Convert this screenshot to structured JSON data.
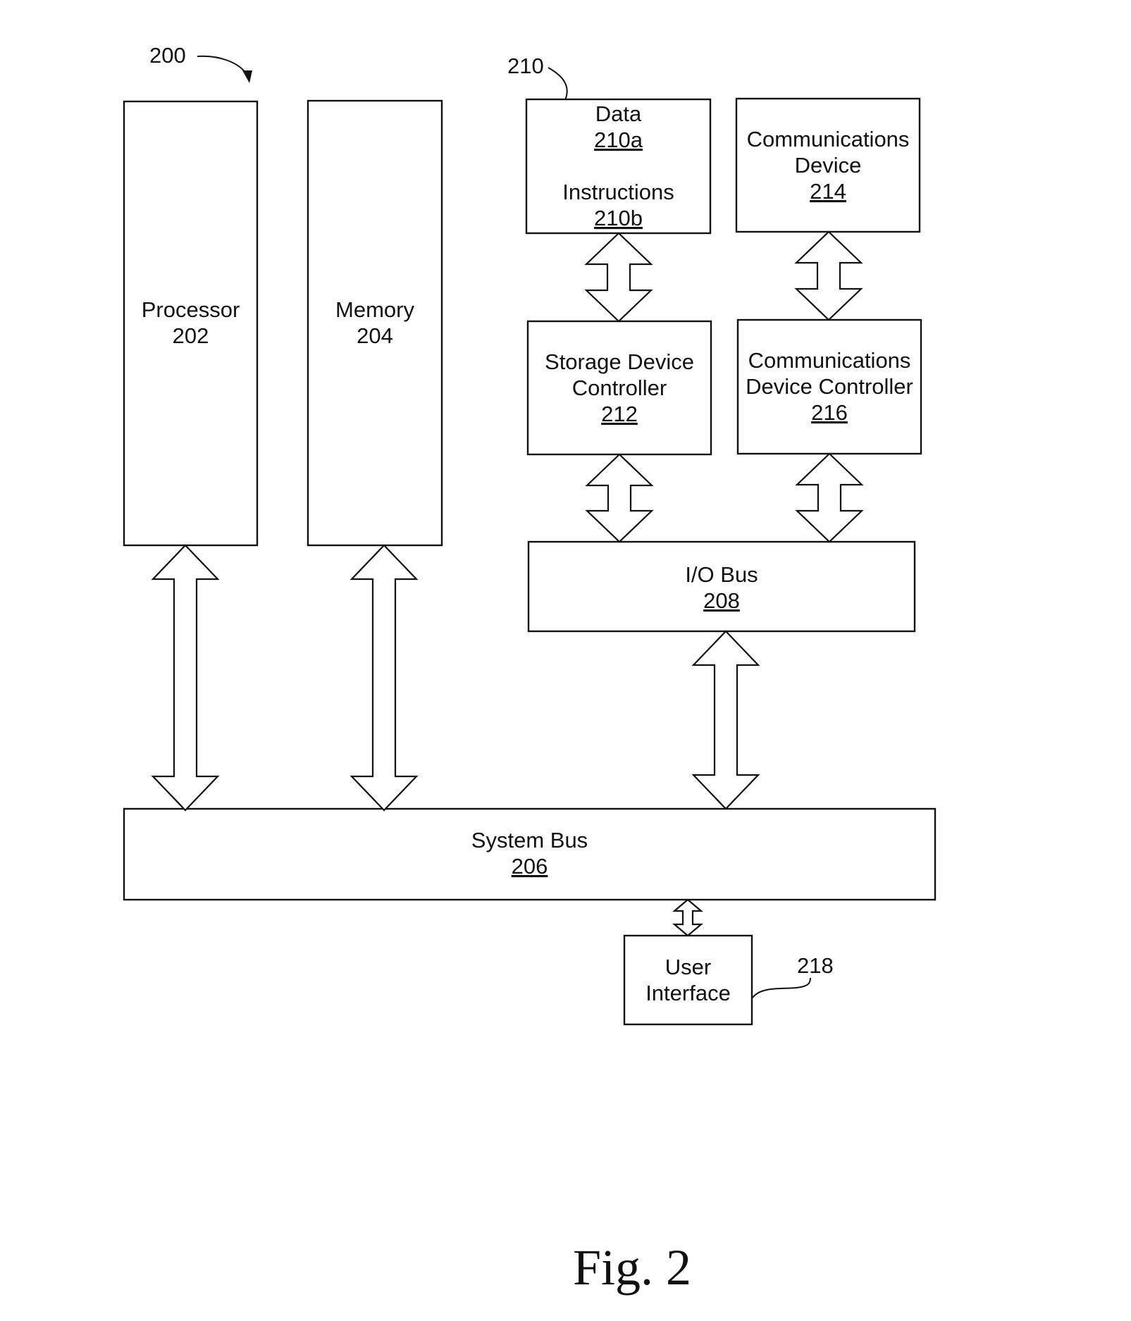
{
  "figure": {
    "caption": "Fig. 2",
    "ref_200": "200",
    "ref_210": "210",
    "ref_218": "218"
  },
  "blocks": {
    "processor": {
      "lines": [
        "Processor",
        "202"
      ],
      "underlined": []
    },
    "memory": {
      "lines": [
        "Memory",
        "204"
      ],
      "underlined": []
    },
    "data_instructions": {
      "lines": [
        "Data",
        "210a",
        "",
        "Instructions",
        "210b"
      ],
      "underlined": [
        1,
        4
      ]
    },
    "comm_device": {
      "lines": [
        "Communications",
        "Device",
        "214"
      ],
      "underlined": [
        2
      ]
    },
    "storage_controller": {
      "lines": [
        "Storage Device",
        "Controller",
        "212"
      ],
      "underlined": [
        2
      ]
    },
    "comm_controller": {
      "lines": [
        "Communications",
        "Device Controller",
        "216"
      ],
      "underlined": [
        2
      ]
    },
    "io_bus": {
      "lines": [
        "I/O Bus",
        "208"
      ],
      "underlined": [
        1
      ]
    },
    "system_bus": {
      "lines": [
        "System Bus",
        "206"
      ],
      "underlined": [
        1
      ]
    },
    "user_interface": {
      "lines": [
        "User",
        "Interface"
      ],
      "underlined": []
    }
  },
  "connections": [
    {
      "from": "data_instructions",
      "to": "storage_controller",
      "type": "bidirectional"
    },
    {
      "from": "comm_device",
      "to": "comm_controller",
      "type": "bidirectional"
    },
    {
      "from": "storage_controller",
      "to": "io_bus",
      "type": "bidirectional"
    },
    {
      "from": "comm_controller",
      "to": "io_bus",
      "type": "bidirectional"
    },
    {
      "from": "io_bus",
      "to": "system_bus",
      "type": "bidirectional"
    },
    {
      "from": "processor",
      "to": "system_bus",
      "type": "bidirectional"
    },
    {
      "from": "memory",
      "to": "system_bus",
      "type": "bidirectional"
    },
    {
      "from": "system_bus",
      "to": "user_interface",
      "type": "bidirectional"
    }
  ]
}
